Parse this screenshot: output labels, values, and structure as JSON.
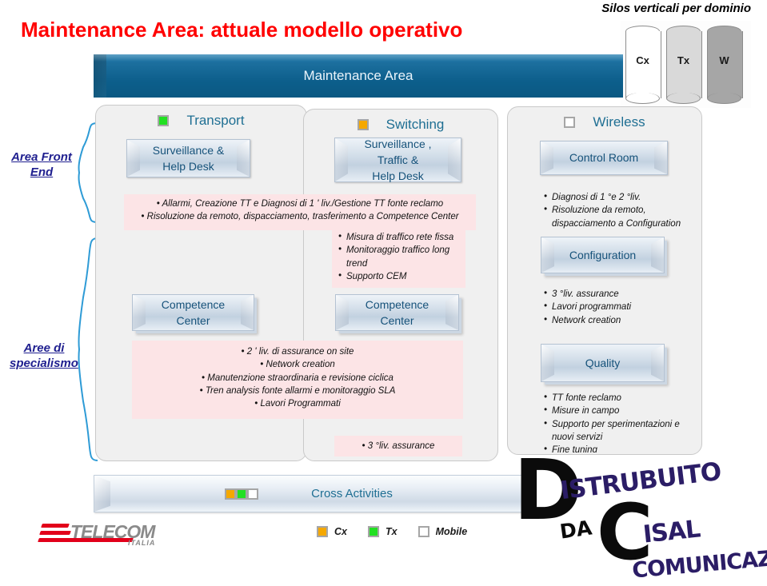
{
  "title": "Maintenance Area: attuale modello operativo",
  "silos_caption": "Silos verticali per dominio",
  "silos": [
    {
      "label": "Cx",
      "color": "#ffffff"
    },
    {
      "label": "Tx",
      "color": "#d9d9d9"
    },
    {
      "label": "W",
      "color": "#a6a6a6"
    }
  ],
  "banner": {
    "label": "Maintenance Area",
    "color": "#0d5f8c"
  },
  "side_labels": {
    "front_end": "Area Front End",
    "front_end_line1": "Area Front",
    "front_end_line2": "End",
    "specialismo_line1": "Aree di",
    "specialismo_line2": "specialismo"
  },
  "columns": {
    "transport": {
      "title": "Transport",
      "swatch": "#22e022",
      "swatch_name": "green-square-icon",
      "front_button": "Surveillance &\nHelp Desk",
      "front_button_line1": "Surveillance &",
      "front_button_line2": "Help Desk",
      "competence_line1": "Competence",
      "competence_line2": "Center"
    },
    "switching": {
      "title": "Switching",
      "swatch": "#f5a800",
      "swatch_name": "orange-square-icon",
      "front_button_line1": "Surveillance ,",
      "front_button_line2": "Traffic  &",
      "front_button_line3": "Help Desk",
      "competence_line1": "Competence",
      "competence_line2": "Center",
      "notes_mid": [
        "Misura di traffico rete fissa",
        "Monitoraggio traffico long trend",
        "Supporto CEM"
      ],
      "notes_bottom": [
        "3 °liv. assurance"
      ]
    },
    "wireless": {
      "title": "Wireless",
      "swatch": "#ffffff",
      "swatch_name": "white-square-icon",
      "control_room": "Control Room",
      "configuration": "Configuration",
      "quality": "Quality",
      "notes_top": [
        "Diagnosi di 1 °e 2 °liv.",
        "Risoluzione da remoto, dispacciamento a Configuration"
      ],
      "notes_mid": [
        "3 °liv. assurance",
        "Lavori programmati",
        "Network creation"
      ],
      "notes_bottom": [
        "TT fonte reclamo",
        "Misure in campo",
        "Supporto per sperimentazioni e nuovi servizi",
        "Fine tuning"
      ]
    }
  },
  "shared_notes": {
    "front_end_spanning": [
      "Allarmi, Creazione TT e Diagnosi di 1 ' liv./Gestione TT fonte reclamo",
      "Risoluzione da remoto, dispacciamento, trasferimento a Competence Center"
    ],
    "specialismo_spanning": [
      "2 ' liv. di assurance on site",
      "Network creation",
      "Manutenzione straordinaria e revisione ciclica",
      "Tren analysis fonte allarmi e monitoraggio SLA",
      "Lavori Programmati"
    ]
  },
  "cross_bar": {
    "label": "Cross Activities"
  },
  "legend": [
    {
      "label": "Cx",
      "color": "#f5a800",
      "icon": "orange-square-icon"
    },
    {
      "label": "Tx",
      "color": "#22e022",
      "icon": "green-square-icon"
    },
    {
      "label": "Mobile",
      "color": "#ffffff",
      "icon": "white-square-icon"
    }
  ],
  "logo": {
    "word": "TELECOM",
    "sub": "ITALIA"
  },
  "watermark": {
    "d": "D",
    "line1": "ISTRUBUITO",
    "da": "DA",
    "c": "C",
    "line2": "ISAL",
    "line3": "COMUNICAZIONE"
  }
}
